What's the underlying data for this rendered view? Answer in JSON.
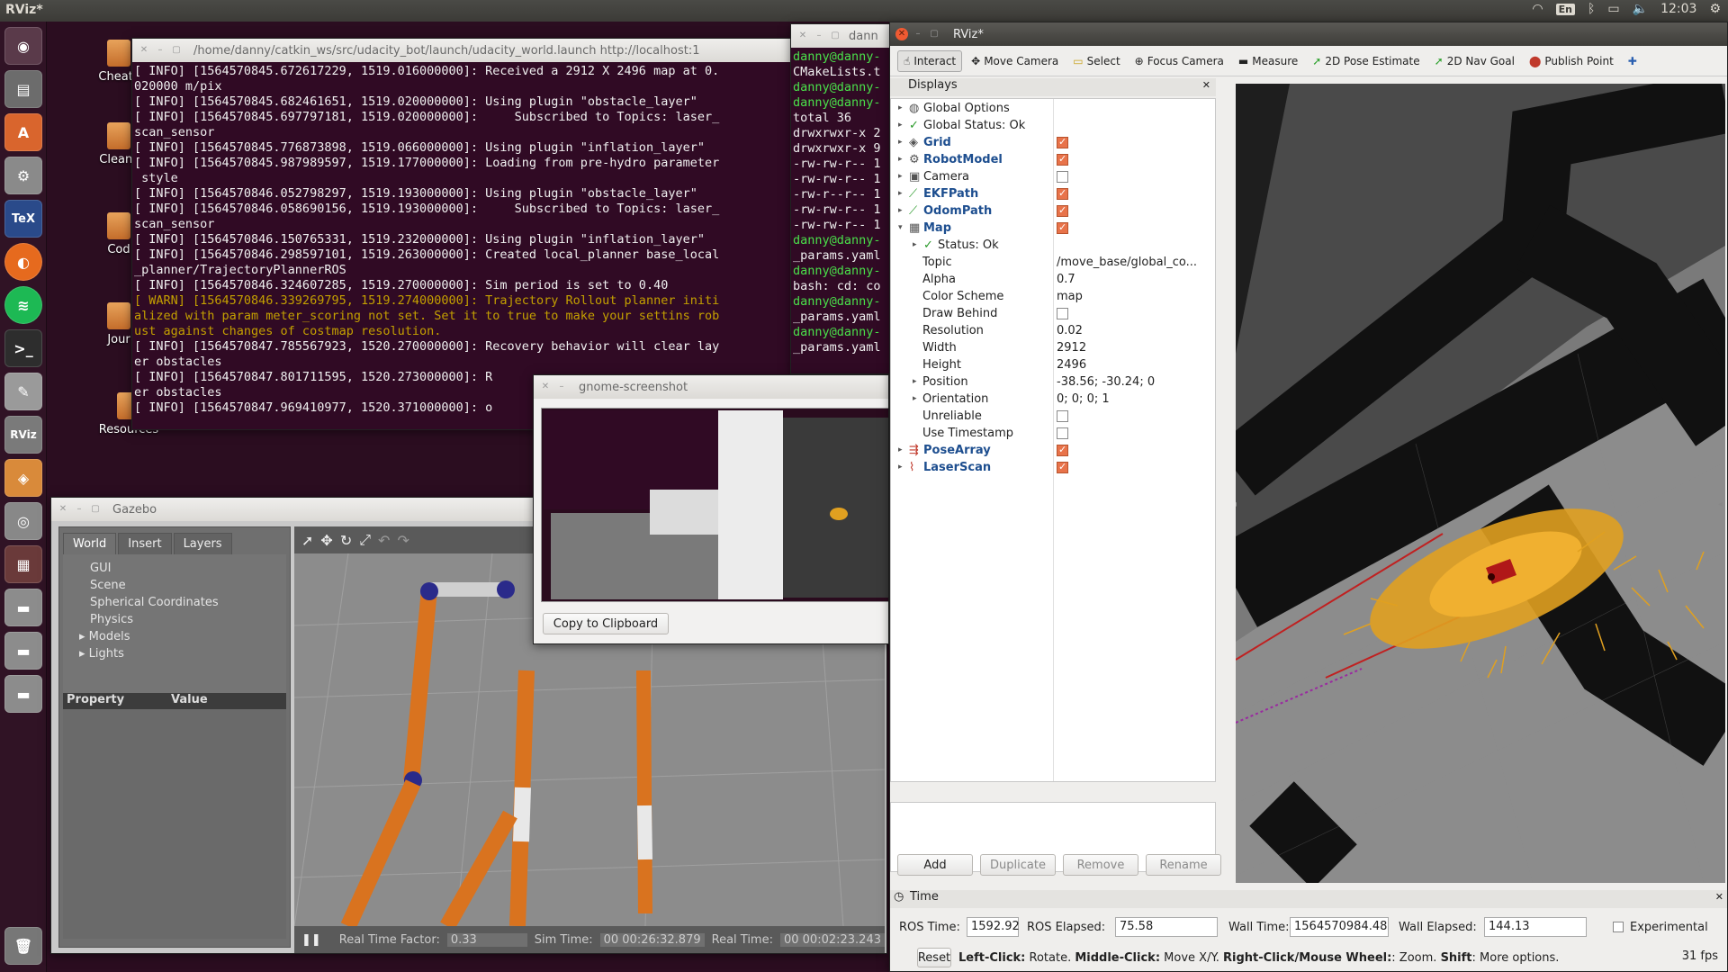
{
  "top_panel": {
    "app_title": "RViz*",
    "keyboard": "En",
    "clock": "12:03"
  },
  "desktop_icons": [
    "Cheats",
    "Clean_",
    "Cod",
    "Jour",
    "Resources"
  ],
  "terminal_main": {
    "title": "/home/danny/catkin_ws/src/udacity_bot/launch/udacity_world.launch http://localhost:1",
    "lines": [
      "[ INFO] [1564570845.672617229, 1519.016000000]: Received a 2912 X 2496 map at 0.",
      "020000 m/pix",
      "[ INFO] [1564570845.682461651, 1519.020000000]: Using plugin \"obstacle_layer\"",
      "[ INFO] [1564570845.697797181, 1519.020000000]:     Subscribed to Topics: laser_",
      "scan_sensor",
      "[ INFO] [1564570845.776873898, 1519.066000000]: Using plugin \"inflation_layer\"",
      "[ INFO] [1564570845.987989597, 1519.177000000]: Loading from pre-hydro parameter",
      " style",
      "[ INFO] [1564570846.052798297, 1519.193000000]: Using plugin \"obstacle_layer\"",
      "[ INFO] [1564570846.058690156, 1519.193000000]:     Subscribed to Topics: laser_",
      "scan_sensor",
      "[ INFO] [1564570846.150765331, 1519.232000000]: Using plugin \"inflation_layer\"",
      "[ INFO] [1564570846.298597101, 1519.263000000]: Created local_planner base_local",
      "_planner/TrajectoryPlannerROS",
      "[ INFO] [1564570846.324607285, 1519.270000000]: Sim period is set to 0.40",
      "[ WARN] [1564570846.339269795, 1519.274000000]: Trajectory Rollout planner initi",
      "alized with param meter_scoring not set. Set it to true to make your settins rob",
      "ust against changes of costmap resolution.",
      "[ INFO] [1564570847.785567923, 1520.270000000]: Recovery behavior will clear lay",
      "er obstacles",
      "[ INFO] [1564570847.801711595, 1520.273000000]: R",
      "er obstacles",
      "[ INFO] [1564570847.969410977, 1520.371000000]: o"
    ]
  },
  "terminal_second": {
    "title": "dann",
    "lines": [
      "danny@danny-",
      "CMakeLists.t",
      "danny@danny-",
      "danny@danny-",
      "total 36",
      "drwxrwxr-x 2",
      "drwxrwxr-x 9",
      "-rw-rw-r-- 1",
      "-rw-rw-r-- 1",
      "-rw-r--r-- 1",
      "-rw-rw-r-- 1",
      "-rw-rw-r-- 1",
      "danny@danny-",
      "_params.yaml",
      "danny@danny-",
      "bash: cd: co",
      "danny@danny-",
      "_params.yaml",
      "danny@danny-",
      "_params.yaml"
    ]
  },
  "screenshot_dialog": {
    "title": "gnome-screenshot",
    "copy_button": "Copy to Clipboard"
  },
  "gazebo": {
    "title": "Gazebo",
    "tabs": [
      "World",
      "Insert",
      "Layers"
    ],
    "tree": [
      "GUI",
      "Scene",
      "Spherical Coordinates",
      "Physics",
      "Models",
      "Lights"
    ],
    "prop_header": "Property",
    "value_header": "Value",
    "rtf_label": "Real Time Factor:",
    "rtf_value": "0.33",
    "sim_time_label": "Sim Time:",
    "sim_time_value": "00 00:26:32.879",
    "real_time_label": "Real Time:",
    "real_time_value": "00 00:02:23.243"
  },
  "rviz": {
    "title": "RViz*",
    "tools": [
      "Interact",
      "Move Camera",
      "Select",
      "Focus Camera",
      "Measure",
      "2D Pose Estimate",
      "2D Nav Goal",
      "Publish Point"
    ],
    "displays_title": "Displays",
    "displays": [
      {
        "name": "Global Options"
      },
      {
        "name": "Global Status: Ok"
      },
      {
        "name": "Grid"
      },
      {
        "name": "RobotModel"
      },
      {
        "name": "Camera"
      },
      {
        "name": "EKFPath"
      },
      {
        "name": "OdomPath"
      },
      {
        "name": "Map"
      },
      {
        "name": "Status: Ok"
      },
      {
        "name": "Topic",
        "value": "/move_base/global_co..."
      },
      {
        "name": "Alpha",
        "value": "0.7"
      },
      {
        "name": "Color Scheme",
        "value": "map"
      },
      {
        "name": "Draw Behind"
      },
      {
        "name": "Resolution",
        "value": "0.02"
      },
      {
        "name": "Width",
        "value": "2912"
      },
      {
        "name": "Height",
        "value": "2496"
      },
      {
        "name": "Position",
        "value": "-38.56; -30.24; 0"
      },
      {
        "name": "Orientation",
        "value": "0; 0; 0; 1"
      },
      {
        "name": "Unreliable"
      },
      {
        "name": "Use Timestamp"
      },
      {
        "name": "PoseArray"
      },
      {
        "name": "LaserScan"
      }
    ],
    "buttons": [
      "Add",
      "Duplicate",
      "Remove",
      "Rename"
    ],
    "time_panel_title": "Time",
    "ros_time_label": "ROS Time:",
    "ros_time": "1592.92",
    "ros_elapsed_label": "ROS Elapsed:",
    "ros_elapsed": "75.58",
    "wall_time_label": "Wall Time:",
    "wall_time": "1564570984.48",
    "wall_elapsed_label": "Wall Elapsed:",
    "wall_elapsed": "144.13",
    "experimental_label": "Experimental",
    "reset_label": "Reset",
    "hint_b1": "Left-Click:",
    "hint_t1": " Rotate. ",
    "hint_b2": "Middle-Click:",
    "hint_t2": " Move X/Y. ",
    "hint_b3": "Right-Click/Mouse Wheel:",
    "hint_t3": ": Zoom. ",
    "hint_b4": "Shift",
    "hint_t4": ": More options.",
    "fps": "31 fps"
  }
}
